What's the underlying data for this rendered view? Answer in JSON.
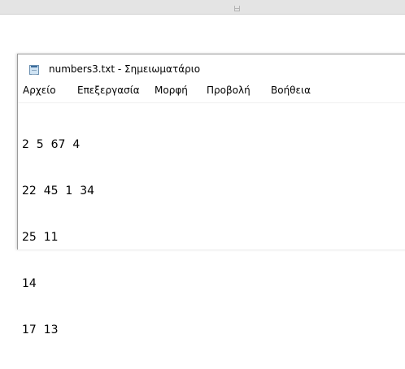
{
  "window": {
    "title": "numbers3.txt - Σημειωματάριο",
    "icon": "notepad-icon"
  },
  "menu": {
    "file": "Αρχείο",
    "edit": "Επεξεργασία",
    "format": "Μορφή",
    "view": "Προβολή",
    "help": "Βοήθεια"
  },
  "editor": {
    "lines": [
      "2  5  67  4",
      "22  45  1  34",
      "25  11",
      "14",
      "17  13"
    ]
  },
  "colors": {
    "background_bar": "#e4e4e4",
    "window_border": "#9a9a9a",
    "text": "#000000"
  }
}
